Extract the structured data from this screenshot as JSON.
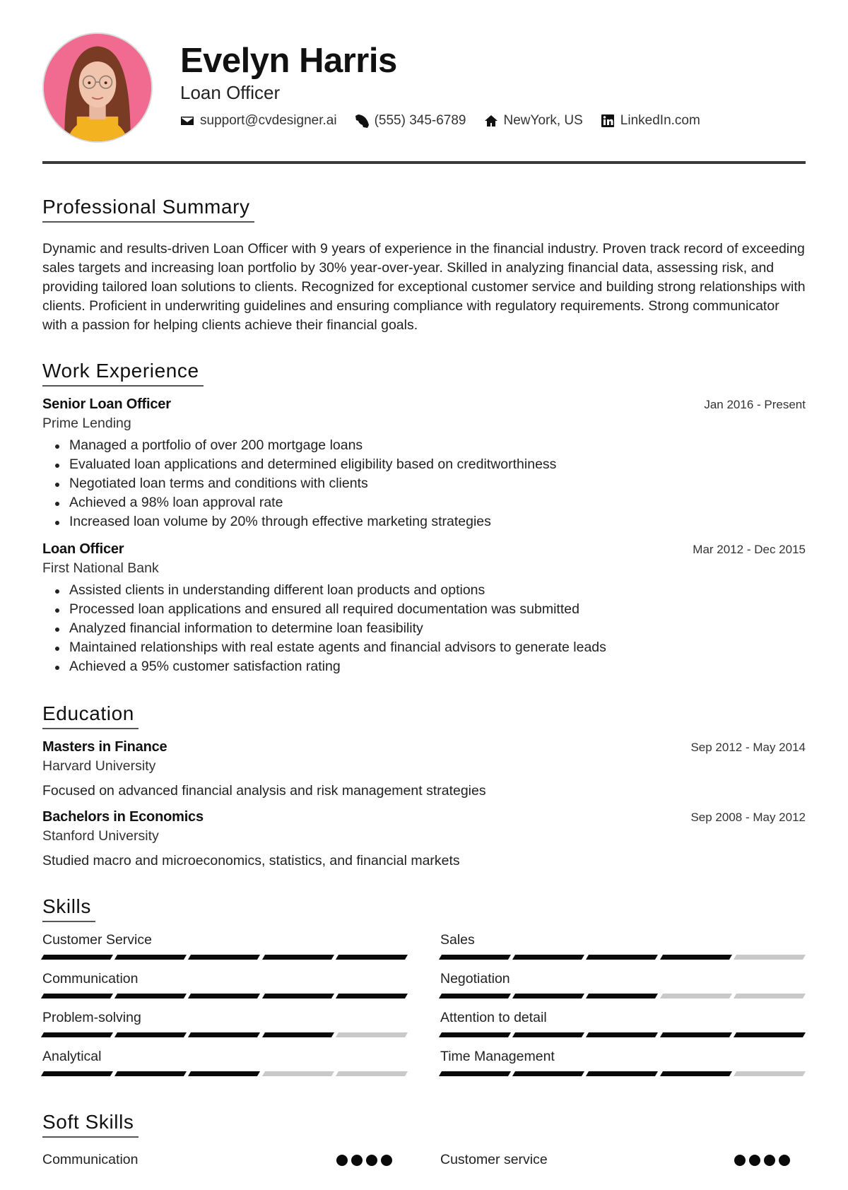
{
  "header": {
    "name": "Evelyn Harris",
    "role": "Loan Officer",
    "avatar_alt": "profile photo",
    "contacts": [
      {
        "icon": "envelope-icon",
        "text": "support@cvdesigner.ai"
      },
      {
        "icon": "phone-icon",
        "text": "(555) 345-6789"
      },
      {
        "icon": "home-icon",
        "text": "NewYork, US"
      },
      {
        "icon": "linkedin-icon",
        "text": "LinkedIn.com"
      }
    ]
  },
  "summary": {
    "title": "Professional Summary",
    "text": "Dynamic and results-driven Loan Officer with 9 years of experience in the financial industry. Proven track record of exceeding sales targets and increasing loan portfolio by 30% year-over-year. Skilled in analyzing financial data, assessing risk, and providing tailored loan solutions to clients. Recognized for exceptional customer service and building strong relationships with clients. Proficient in underwriting guidelines and ensuring compliance with regulatory requirements. Strong communicator with a passion for helping clients achieve their financial goals."
  },
  "experience": {
    "title": "Work Experience",
    "jobs": [
      {
        "title": "Senior Loan Officer",
        "company": "Prime Lending",
        "date": "Jan 2016 - Present",
        "bullets": [
          "Managed a portfolio of over 200 mortgage loans",
          "Evaluated loan applications and determined eligibility based on creditworthiness",
          "Negotiated loan terms and conditions with clients",
          "Achieved a 98% loan approval rate",
          "Increased loan volume by 20% through effective marketing strategies"
        ]
      },
      {
        "title": "Loan Officer",
        "company": "First National Bank",
        "date": "Mar 2012 - Dec 2015",
        "bullets": [
          "Assisted clients in understanding different loan products and options",
          "Processed loan applications and ensured all required documentation was submitted",
          "Analyzed financial information to determine loan feasibility",
          "Maintained relationships with real estate agents and financial advisors to generate leads",
          "Achieved a 95% customer satisfaction rating"
        ]
      }
    ]
  },
  "education": {
    "title": "Education",
    "items": [
      {
        "degree": "Masters in Finance",
        "school": "Harvard University",
        "date": "Sep 2012 - May 2014",
        "desc": "Focused on advanced financial analysis and risk management strategies"
      },
      {
        "degree": "Bachelors in Economics",
        "school": "Stanford University",
        "date": "Sep 2008 - May 2012",
        "desc": "Studied macro and microeconomics, statistics, and financial markets"
      }
    ]
  },
  "skills": {
    "title": "Skills",
    "max": 5,
    "items": [
      {
        "name": "Customer Service",
        "level": 5
      },
      {
        "name": "Sales",
        "level": 4
      },
      {
        "name": "Communication",
        "level": 5
      },
      {
        "name": "Negotiation",
        "level": 3
      },
      {
        "name": "Problem-solving",
        "level": 4
      },
      {
        "name": "Attention to detail",
        "level": 5
      },
      {
        "name": "Analytical",
        "level": 3
      },
      {
        "name": "Time Management",
        "level": 4
      }
    ]
  },
  "soft_skills": {
    "title": "Soft Skills",
    "max": 4,
    "items": [
      {
        "name": "Communication",
        "level": 4
      },
      {
        "name": "Customer service",
        "level": 4
      }
    ]
  }
}
